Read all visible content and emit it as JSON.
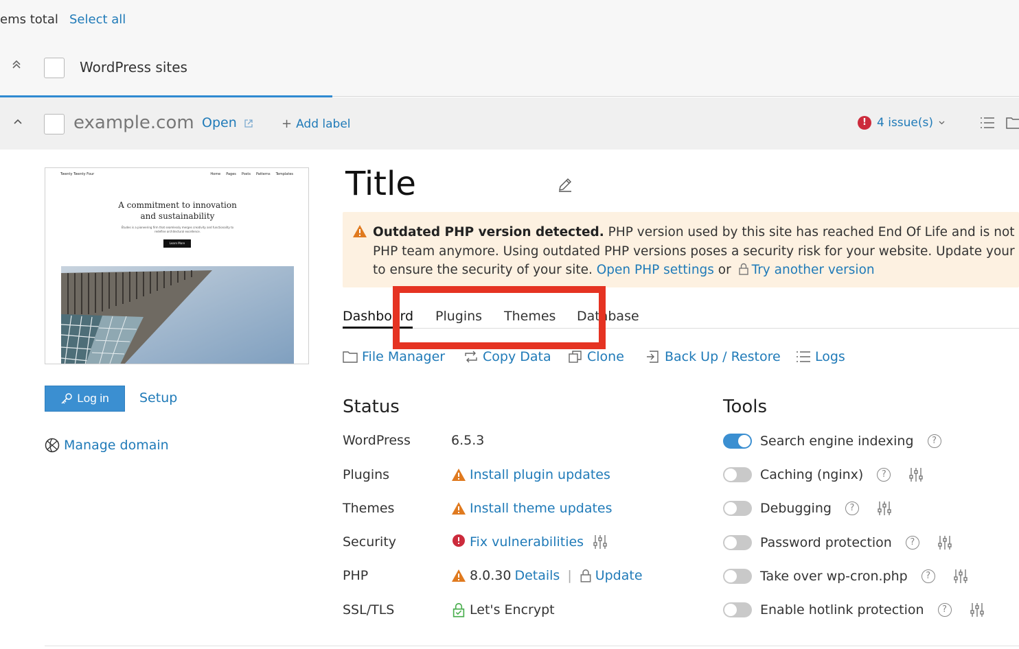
{
  "header": {
    "items_total": "ems total",
    "select_all": "Select all",
    "group_label": "WordPress sites"
  },
  "site": {
    "domain": "example.com",
    "open_label": "Open",
    "add_label": "Add label",
    "issues_label": "4 issue(s)",
    "issue_badge": "!"
  },
  "preview": {
    "brand": "Twenty Twenty Four",
    "nav": [
      "Home",
      "Pages",
      "Posts",
      "Patterns",
      "Templates"
    ],
    "headline": "A commitment to innovation and sustainability",
    "subtext": "Études is a pioneering firm that seamlessly merges creativity and functionality to redefine architectural excellence.",
    "button": "Learn More"
  },
  "sidebar": {
    "login_label": "Log in",
    "setup_label": "Setup",
    "manage_domain_label": "Manage domain"
  },
  "title": "Title",
  "warning": {
    "bold": "Outdated PHP version detected.",
    "line1_rest": " PHP version used by this site has reached End Of Life and is not suppor",
    "line2": "PHP team anymore. Using outdated PHP versions poses a security risk for your website. Update your PHP",
    "line3_prefix": "to ensure the security of your site. ",
    "open_php_settings": "Open PHP settings",
    "or": " or ",
    "try_another": "Try another version"
  },
  "tabs": [
    {
      "label": "Dashboard"
    },
    {
      "label": "Plugins"
    },
    {
      "label": "Themes"
    },
    {
      "label": "Database"
    }
  ],
  "actions": [
    {
      "label": "File Manager"
    },
    {
      "label": "Copy Data"
    },
    {
      "label": "Clone"
    },
    {
      "label": "Back Up / Restore"
    },
    {
      "label": "Logs"
    }
  ],
  "status": {
    "heading": "Status",
    "rows": [
      {
        "label": "WordPress",
        "value": "6.5.3"
      },
      {
        "label": "Plugins",
        "value": "Install plugin updates"
      },
      {
        "label": "Themes",
        "value": "Install theme updates"
      },
      {
        "label": "Security",
        "value": "Fix vulnerabilities"
      },
      {
        "label": "PHP",
        "value": "8.0.30",
        "details": "Details",
        "update": "Update"
      },
      {
        "label": "SSL/TLS",
        "value": "Let's Encrypt"
      }
    ]
  },
  "tools": {
    "heading": "Tools",
    "rows": [
      {
        "label": "Search engine indexing",
        "enabled": true
      },
      {
        "label": "Caching (nginx)",
        "enabled": false
      },
      {
        "label": "Debugging",
        "enabled": false
      },
      {
        "label": "Password protection",
        "enabled": false
      },
      {
        "label": "Take over wp-cron.php",
        "enabled": false
      },
      {
        "label": "Enable hotlink protection",
        "enabled": false
      }
    ]
  },
  "colors": {
    "accent": "#1f7ab8",
    "highlight": "#e53322",
    "warning_bg": "#fdf1e1",
    "error": "#cc2b3c",
    "warning": "#e07a1f"
  }
}
